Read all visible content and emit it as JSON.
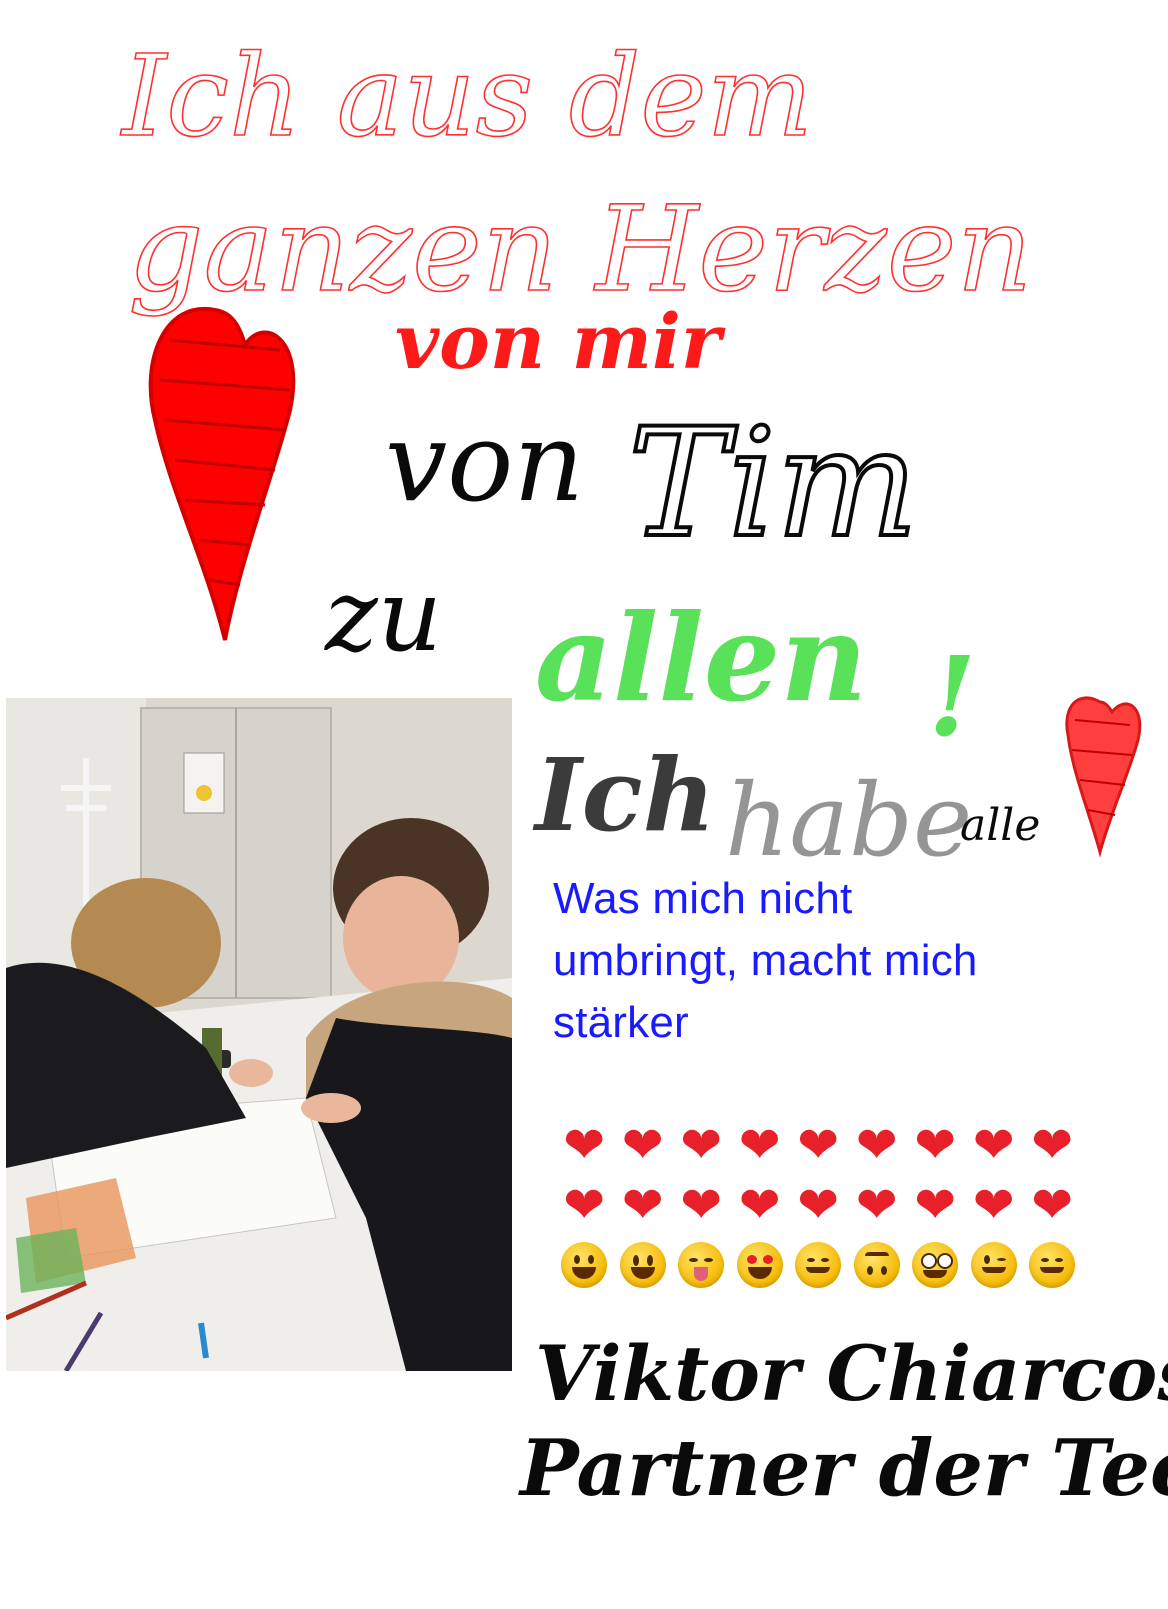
{
  "handwriting": {
    "line1": "Ich aus dem",
    "line2": "ganzen Herzen",
    "line3": "von mir",
    "line4_a": "von",
    "line4_b": "Tim",
    "line5_a": "zu",
    "line5_b": "allen",
    "line5_c": "!",
    "line6_a": "Ich",
    "line6_b": "habe",
    "line6_c": "alle"
  },
  "quote": {
    "line1": "Was mich nicht",
    "line2": "umbringt, macht mich",
    "line3": "stärker"
  },
  "emoji_rows": [
    [
      "red-heart",
      "red-heart",
      "red-heart",
      "red-heart",
      "red-heart",
      "red-heart",
      "red-heart",
      "red-heart",
      "red-heart"
    ],
    [
      "red-heart",
      "red-heart",
      "red-heart",
      "red-heart",
      "red-heart",
      "red-heart",
      "red-heart",
      "red-heart",
      "red-heart"
    ],
    [
      "grinning-face",
      "grinning-face-big-eyes",
      "squinting-tongue-face",
      "heart-eyes-face",
      "smiling-face-with-hearts",
      "upside-down-face",
      "nerd-face",
      "winking-face",
      "smiling-face-with-hearts"
    ]
  ],
  "signature": {
    "name": "Viktor Chiarcos",
    "role": "Partner der Technik"
  },
  "colors": {
    "red_ink": "#ff1a1a",
    "black_ink": "#0a0a0a",
    "green_ink": "#3ddc3d",
    "blue_text": "#1a1aff",
    "heart_fill": "#ff0000"
  }
}
